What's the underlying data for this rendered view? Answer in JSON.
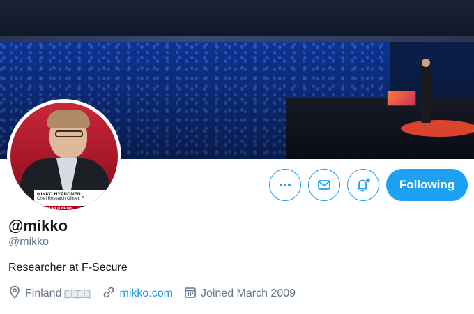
{
  "profile": {
    "display_name": "@mikko",
    "handle": "@mikko",
    "bio": "Researcher at F-Secure",
    "location": "Finland",
    "website": "mikko.com",
    "joined": "Joined March 2009"
  },
  "avatar": {
    "caption_name": "MIKKO HYPPONEN",
    "caption_role": "Chief Research Officer, F",
    "caption_brand": "BBC WORLD NEWS"
  },
  "actions": {
    "more_icon": "more-horizontal-icon",
    "message_icon": "envelope-icon",
    "notify_icon": "bell-plus-icon",
    "follow_label": "Following"
  },
  "colors": {
    "accent": "#1da1f2",
    "link": "#1b95e0",
    "secondary_text": "#657786"
  }
}
